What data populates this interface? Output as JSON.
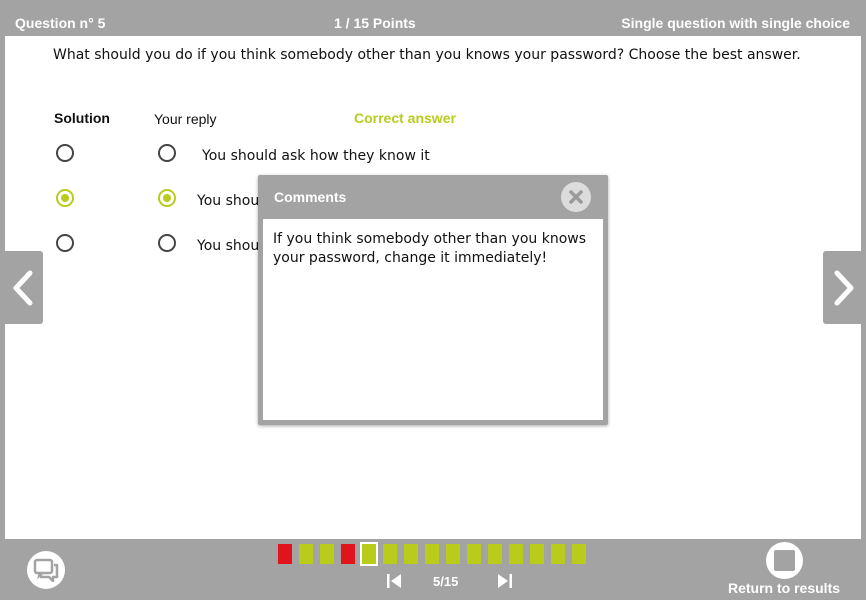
{
  "header": {
    "question_number": "Question n° 5",
    "points": "1 / 15 Points",
    "question_type": "Single question with single choice"
  },
  "question": {
    "text": "What should you do if you think somebody other than you knows your password? Choose the best answer."
  },
  "columns": {
    "solution": "Solution",
    "reply": "Your reply",
    "correct": "Correct answer"
  },
  "answers": [
    {
      "text": "You should ask how they know it",
      "solution_checked": false,
      "reply_checked": false
    },
    {
      "text": "You shou",
      "solution_checked": true,
      "reply_checked": true
    },
    {
      "text": "You shou",
      "solution_checked": false,
      "reply_checked": false
    }
  ],
  "comments_dialog": {
    "title": "Comments",
    "body": "If you think somebody other than you knows your password, change it immediately!",
    "close_icon": "close-x-icon"
  },
  "progress": {
    "squares": [
      "red",
      "green",
      "green",
      "red",
      "current",
      "green",
      "green",
      "green",
      "green",
      "green",
      "green",
      "green",
      "green",
      "green",
      "green"
    ],
    "page_indicator": "5/15",
    "colors": {
      "correct": "#b9cc1c",
      "wrong": "#e2141b",
      "bar": "#a3a3a3"
    }
  },
  "footer": {
    "return_label": "Return to results"
  },
  "icons": {
    "prev": "chevron-left-icon",
    "next": "chevron-right-icon",
    "chat": "chat-bubbles-icon",
    "first": "skip-first-icon",
    "last": "skip-last-icon",
    "return": "stop-square-icon"
  }
}
